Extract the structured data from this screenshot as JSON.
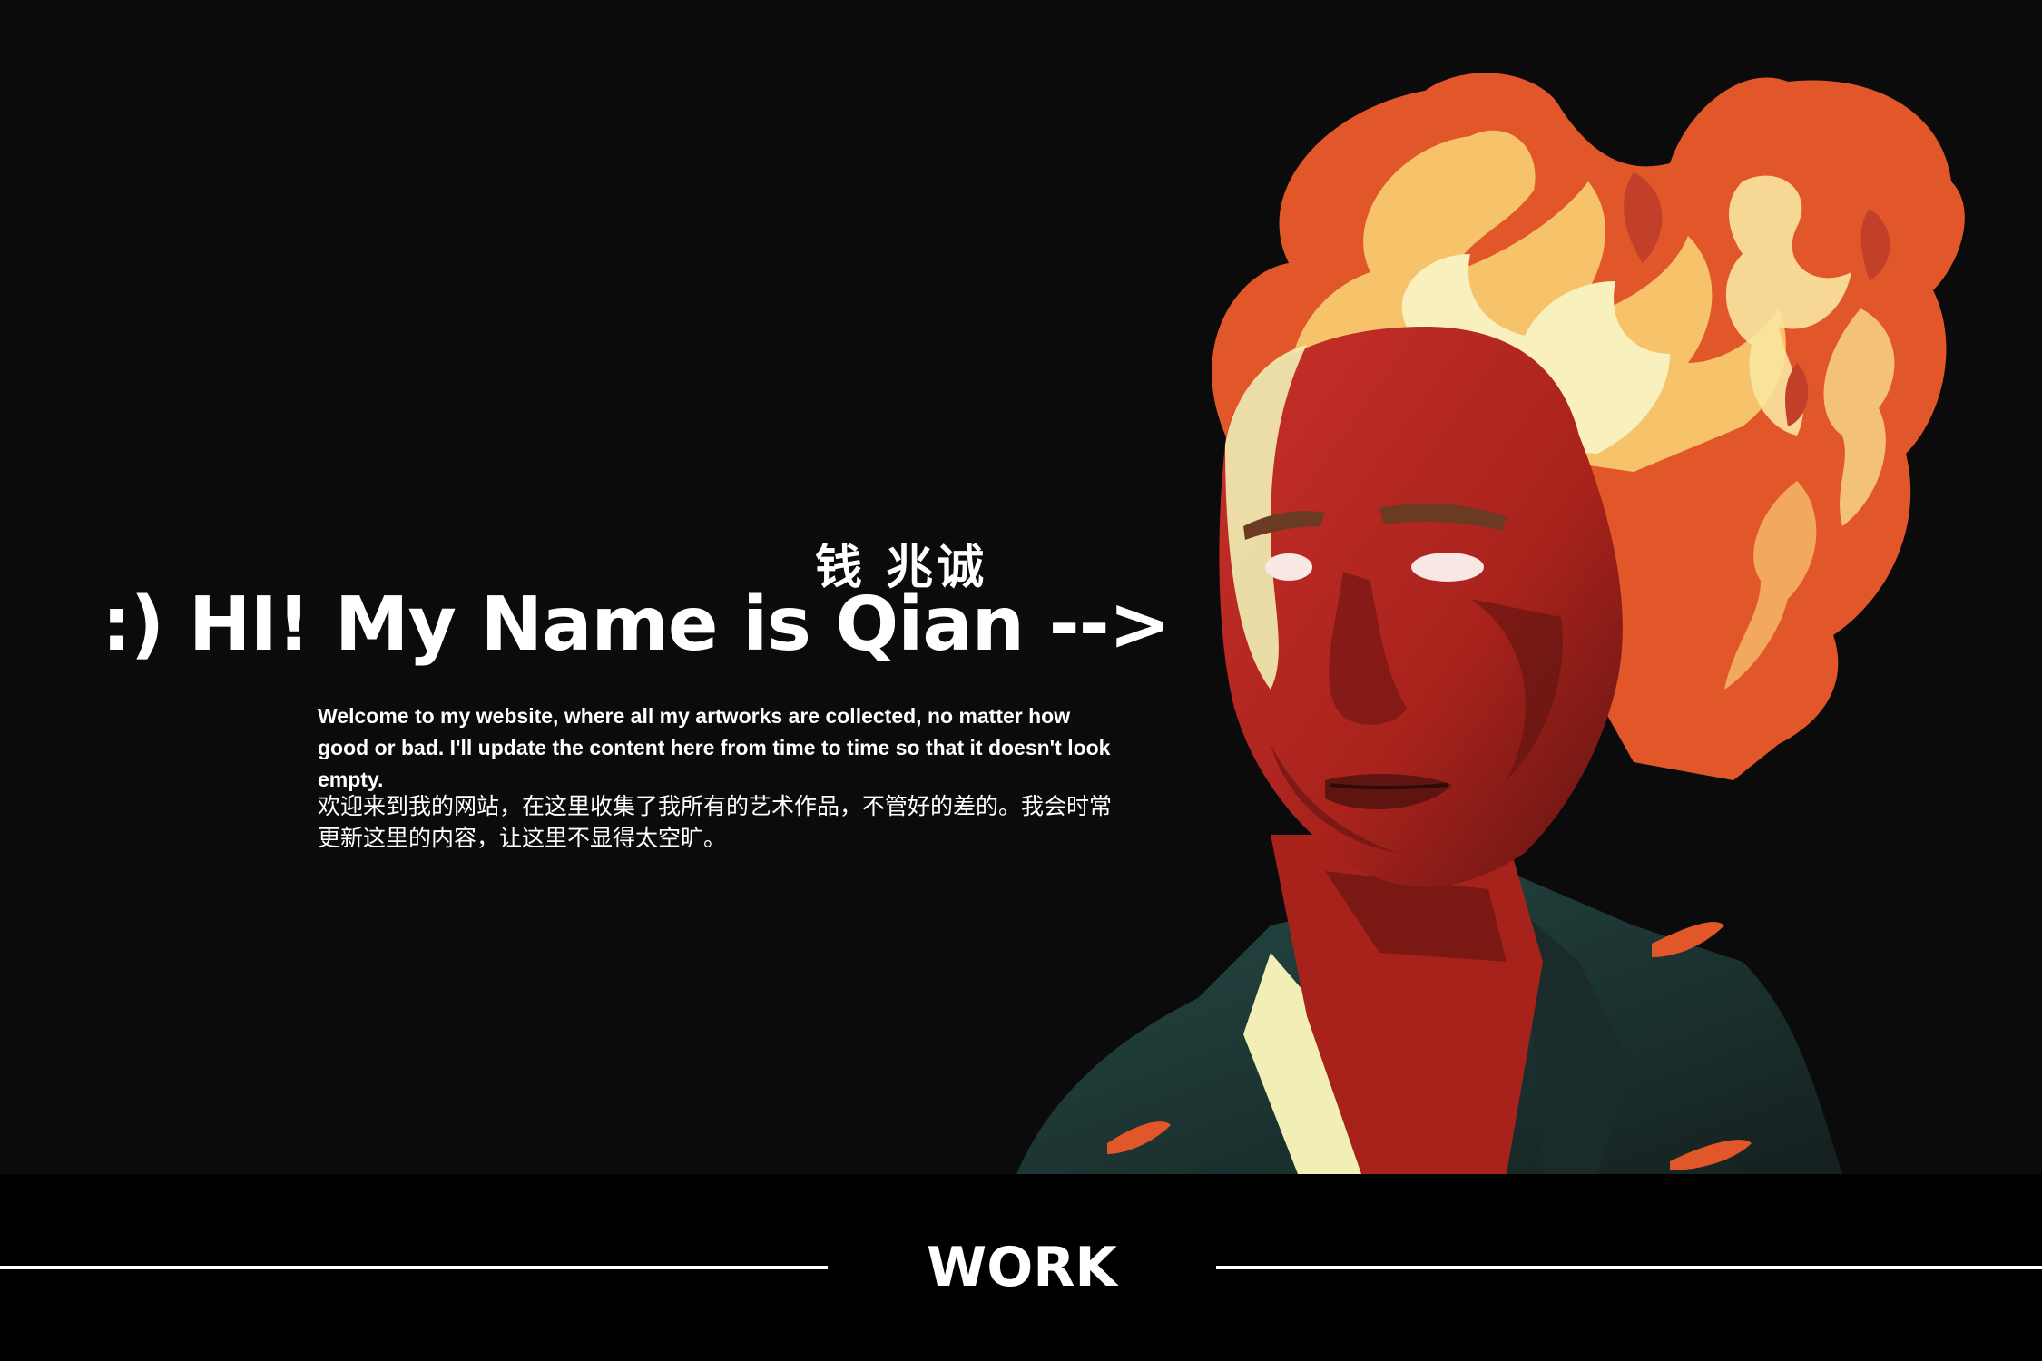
{
  "hero": {
    "name_chinese": "钱 兆诚",
    "greeting": ":) HI! My Name is Qian -->",
    "intro_english": "Welcome to my website, where all my artworks are collected, no matter how good or bad. I'll update the content here from time to time so that it doesn't look empty.",
    "intro_chinese": "欢迎来到我的网站，在这里收集了我所有的艺术作品，不管好的差的。我会时常更新这里的内容，让这里不显得太空旷。",
    "portrait_icon": "flaming-head-portrait-illustration"
  },
  "footer": {
    "section_label": "WORK"
  },
  "colors": {
    "background": "#0b0b0b",
    "footer_background": "#000000",
    "text": "#ffffff",
    "flame_orange": "#e2572a",
    "flame_light": "#f7efb0",
    "skin_red": "#b8281f",
    "shirt_teal": "#1f3b3a"
  }
}
